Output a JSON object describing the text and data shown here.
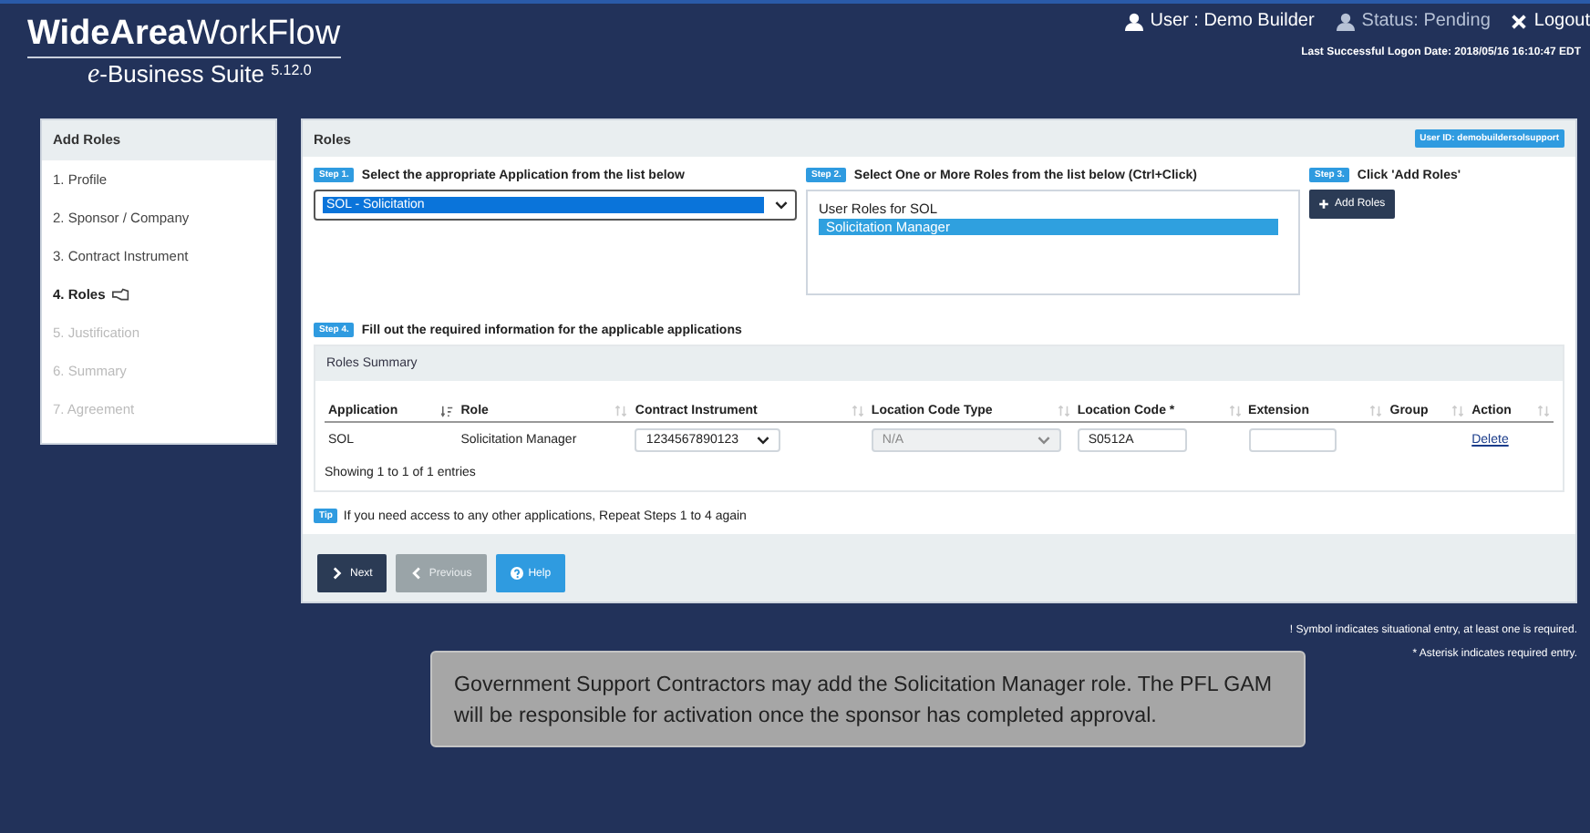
{
  "header": {
    "logo_bold": "WideArea",
    "logo_rest": "WorkFlow",
    "suite_prefix": "e",
    "suite_name": "-Business Suite",
    "version": "5.12.0",
    "user": "User : Demo Builder",
    "status": "Status: Pending",
    "logout": "Logout",
    "last_logon": "Last Successful Logon Date: 2018/05/16 16:10:47 EDT"
  },
  "sidebar": {
    "title": "Add Roles",
    "items": [
      {
        "label": "1. Profile",
        "selected": false,
        "disabled": false
      },
      {
        "label": "2. Sponsor / Company",
        "selected": false,
        "disabled": false
      },
      {
        "label": "3. Contract Instrument",
        "selected": false,
        "disabled": false
      },
      {
        "label": "4. Roles",
        "selected": true,
        "disabled": false
      },
      {
        "label": "5. Justification",
        "selected": false,
        "disabled": true
      },
      {
        "label": "6. Summary",
        "selected": false,
        "disabled": true
      },
      {
        "label": "7. Agreement",
        "selected": false,
        "disabled": true
      }
    ]
  },
  "panel": {
    "title": "Roles",
    "user_id": "User ID: demobuildersolsupport",
    "step1": {
      "badge": "Step 1.",
      "text": "Select the appropriate Application from the list below",
      "value": "SOL - Solicitation"
    },
    "step2": {
      "badge": "Step 2.",
      "text": "Select One or More Roles from the list below (Ctrl+Click)",
      "group": "User Roles for SOL",
      "options": [
        {
          "label": "Solicitation Manager",
          "selected": true
        }
      ]
    },
    "step3": {
      "badge": "Step 3.",
      "text": "Click 'Add Roles'",
      "button": "Add Roles"
    },
    "step4": {
      "badge": "Step 4.",
      "text": "Fill out the required information for the applicable applications"
    },
    "roles_summary": {
      "title": "Roles Summary",
      "columns": [
        {
          "label": "Application",
          "sorted": true
        },
        {
          "label": "Role",
          "sorted": false
        },
        {
          "label": "Contract Instrument",
          "sorted": false
        },
        {
          "label": "Location Code Type",
          "sorted": false
        },
        {
          "label": "Location Code *",
          "sorted": false
        },
        {
          "label": "Extension",
          "sorted": false
        },
        {
          "label": "Group",
          "sorted": false
        },
        {
          "label": "Action",
          "sorted": false
        }
      ],
      "rows": [
        {
          "application": "SOL",
          "role": "Solicitation Manager",
          "contract_instrument": "1234567890123",
          "location_code_type": {
            "value": "N/A",
            "disabled": true
          },
          "location_code": "S0512A",
          "action": "Delete"
        }
      ],
      "info": "Showing 1 to 1 of 1 entries"
    },
    "tip": {
      "badge": "Tip",
      "text": "If you need access to any other applications, Repeat Steps 1 to 4 again"
    },
    "buttons": [
      {
        "label": "Next",
        "kind": "next"
      },
      {
        "label": "Previous",
        "kind": "previous"
      },
      {
        "label": "Help",
        "kind": "help"
      }
    ]
  },
  "notes": [
    "! Symbol indicates situational entry, at least one is required.",
    "* Asterisk indicates required entry."
  ],
  "callout": "Government Support Contractors may add the Solicitation Manager role. The PFL GAM will be responsible for activation once the sponsor has completed approval."
}
